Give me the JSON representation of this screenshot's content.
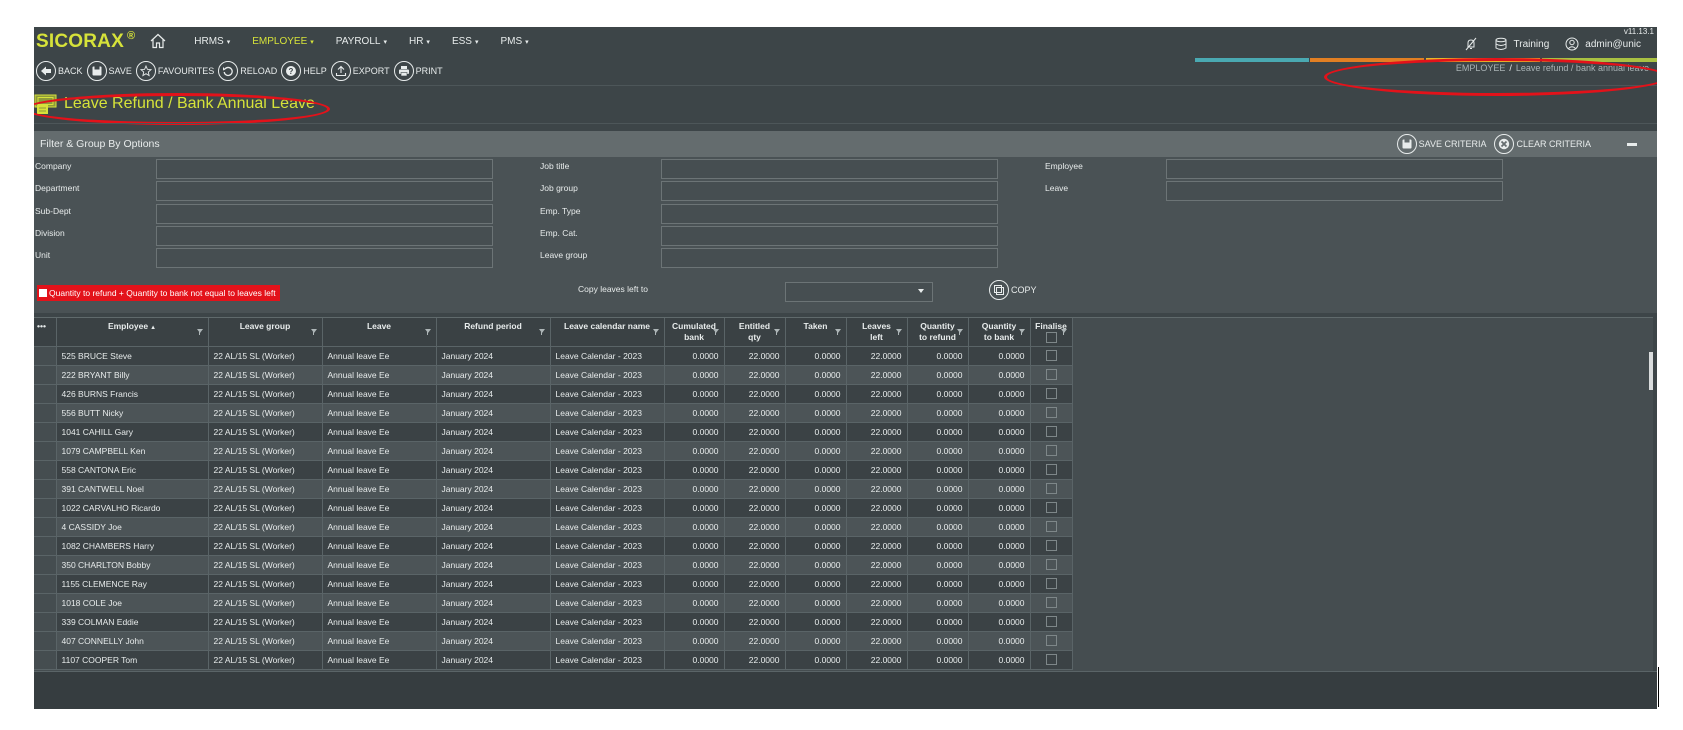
{
  "app": {
    "logo": "SICORAX",
    "logo_mark": "®",
    "version": "v11.13.1",
    "nav": [
      {
        "label": "HRMS",
        "active": false
      },
      {
        "label": "EMPLOYEE",
        "active": true
      },
      {
        "label": "PAYROLL",
        "active": false
      },
      {
        "label": "HR",
        "active": false
      },
      {
        "label": "ESS",
        "active": false
      },
      {
        "label": "PMS",
        "active": false
      }
    ],
    "environment": "Training",
    "user": "admin@unic",
    "colors": {
      "accent": "#d6e23a",
      "background": "#3d4548",
      "warning": "#e3121a",
      "ribbon": [
        "#4aa9b2",
        "#e27f23",
        "#e6b72a",
        "#a9c142"
      ]
    }
  },
  "toolbar": {
    "back": "BACK",
    "save": "SAVE",
    "favourites": "FAVOURITES",
    "reload": "RELOAD",
    "help": "HELP",
    "export": "EXPORT",
    "print": "PRINT"
  },
  "breadcrumb": {
    "section": "EMPLOYEE",
    "separator": "/",
    "page": "Leave refund / bank annual leave"
  },
  "page": {
    "title": "Leave Refund / Bank Annual Leave"
  },
  "filter": {
    "title": "Filter & Group By Options",
    "save_criteria": "SAVE CRITERIA",
    "clear_criteria": "CLEAR CRITERIA",
    "col1": [
      {
        "label": "Company",
        "value": ""
      },
      {
        "label": "Department",
        "value": ""
      },
      {
        "label": "Sub-Dept",
        "value": ""
      },
      {
        "label": "Division",
        "value": ""
      },
      {
        "label": "Unit",
        "value": ""
      }
    ],
    "col2": [
      {
        "label": "Job title",
        "value": ""
      },
      {
        "label": "Job group",
        "value": ""
      },
      {
        "label": "Emp. Type",
        "value": ""
      },
      {
        "label": "Emp. Cat.",
        "value": ""
      },
      {
        "label": "Leave group",
        "value": ""
      }
    ],
    "col3": [
      {
        "label": "Employee",
        "value": ""
      },
      {
        "label": "Leave",
        "value": ""
      }
    ],
    "warning_checkbox": "Quantity to refund + Quantity to bank not equal to leaves left",
    "copy_label": "Copy leaves left to",
    "copy_select_value": "",
    "copy_button": "COPY"
  },
  "grid": {
    "columns": [
      {
        "line1": "Employee",
        "line2": "",
        "sorted": "asc"
      },
      {
        "line1": "Leave group",
        "line2": ""
      },
      {
        "line1": "Leave",
        "line2": ""
      },
      {
        "line1": "Refund period",
        "line2": ""
      },
      {
        "line1": "Leave calendar name",
        "line2": ""
      },
      {
        "line1": "Cumulated",
        "line2": "bank"
      },
      {
        "line1": "Entitled",
        "line2": "qty"
      },
      {
        "line1": "Taken",
        "line2": ""
      },
      {
        "line1": "Leaves",
        "line2": "left"
      },
      {
        "line1": "Quantity",
        "line2": "to refund"
      },
      {
        "line1": "Quantity",
        "line2": "to bank"
      },
      {
        "line1": "Finalise",
        "line2": ""
      }
    ],
    "menu_icon": "•••",
    "rows": [
      {
        "employee": "525 BRUCE Steve",
        "leave_group": "22 AL/15 SL (Worker)",
        "leave": "Annual leave Ee",
        "refund_period": "January 2024",
        "calendar": "Leave Calendar - 2023",
        "cumulated_bank": "0.0000",
        "entitled_qty": "22.0000",
        "taken": "0.0000",
        "leaves_left": "22.0000",
        "qty_refund": "0.0000",
        "qty_bank": "0.0000",
        "finalise": false
      },
      {
        "employee": "222 BRYANT Billy",
        "leave_group": "22 AL/15 SL (Worker)",
        "leave": "Annual leave Ee",
        "refund_period": "January 2024",
        "calendar": "Leave Calendar - 2023",
        "cumulated_bank": "0.0000",
        "entitled_qty": "22.0000",
        "taken": "0.0000",
        "leaves_left": "22.0000",
        "qty_refund": "0.0000",
        "qty_bank": "0.0000",
        "finalise": false
      },
      {
        "employee": "426 BURNS Francis",
        "leave_group": "22 AL/15 SL (Worker)",
        "leave": "Annual leave Ee",
        "refund_period": "January 2024",
        "calendar": "Leave Calendar - 2023",
        "cumulated_bank": "0.0000",
        "entitled_qty": "22.0000",
        "taken": "0.0000",
        "leaves_left": "22.0000",
        "qty_refund": "0.0000",
        "qty_bank": "0.0000",
        "finalise": false
      },
      {
        "employee": "556 BUTT Nicky",
        "leave_group": "22 AL/15 SL (Worker)",
        "leave": "Annual leave Ee",
        "refund_period": "January 2024",
        "calendar": "Leave Calendar - 2023",
        "cumulated_bank": "0.0000",
        "entitled_qty": "22.0000",
        "taken": "0.0000",
        "leaves_left": "22.0000",
        "qty_refund": "0.0000",
        "qty_bank": "0.0000",
        "finalise": false
      },
      {
        "employee": "1041 CAHILL Gary",
        "leave_group": "22 AL/15 SL (Worker)",
        "leave": "Annual leave Ee",
        "refund_period": "January 2024",
        "calendar": "Leave Calendar - 2023",
        "cumulated_bank": "0.0000",
        "entitled_qty": "22.0000",
        "taken": "0.0000",
        "leaves_left": "22.0000",
        "qty_refund": "0.0000",
        "qty_bank": "0.0000",
        "finalise": false
      },
      {
        "employee": "1079 CAMPBELL Ken",
        "leave_group": "22 AL/15 SL (Worker)",
        "leave": "Annual leave Ee",
        "refund_period": "January 2024",
        "calendar": "Leave Calendar - 2023",
        "cumulated_bank": "0.0000",
        "entitled_qty": "22.0000",
        "taken": "0.0000",
        "leaves_left": "22.0000",
        "qty_refund": "0.0000",
        "qty_bank": "0.0000",
        "finalise": false
      },
      {
        "employee": "558 CANTONA Eric",
        "leave_group": "22 AL/15 SL (Worker)",
        "leave": "Annual leave Ee",
        "refund_period": "January 2024",
        "calendar": "Leave Calendar - 2023",
        "cumulated_bank": "0.0000",
        "entitled_qty": "22.0000",
        "taken": "0.0000",
        "leaves_left": "22.0000",
        "qty_refund": "0.0000",
        "qty_bank": "0.0000",
        "finalise": false
      },
      {
        "employee": "391 CANTWELL Noel",
        "leave_group": "22 AL/15 SL (Worker)",
        "leave": "Annual leave Ee",
        "refund_period": "January 2024",
        "calendar": "Leave Calendar - 2023",
        "cumulated_bank": "0.0000",
        "entitled_qty": "22.0000",
        "taken": "0.0000",
        "leaves_left": "22.0000",
        "qty_refund": "0.0000",
        "qty_bank": "0.0000",
        "finalise": false
      },
      {
        "employee": "1022 CARVALHO Ricardo",
        "leave_group": "22 AL/15 SL (Worker)",
        "leave": "Annual leave Ee",
        "refund_period": "January 2024",
        "calendar": "Leave Calendar - 2023",
        "cumulated_bank": "0.0000",
        "entitled_qty": "22.0000",
        "taken": "0.0000",
        "leaves_left": "22.0000",
        "qty_refund": "0.0000",
        "qty_bank": "0.0000",
        "finalise": false
      },
      {
        "employee": "4 CASSIDY Joe",
        "leave_group": "22 AL/15 SL (Worker)",
        "leave": "Annual leave Ee",
        "refund_period": "January 2024",
        "calendar": "Leave Calendar - 2023",
        "cumulated_bank": "0.0000",
        "entitled_qty": "22.0000",
        "taken": "0.0000",
        "leaves_left": "22.0000",
        "qty_refund": "0.0000",
        "qty_bank": "0.0000",
        "finalise": false
      },
      {
        "employee": "1082 CHAMBERS Harry",
        "leave_group": "22 AL/15 SL (Worker)",
        "leave": "Annual leave Ee",
        "refund_period": "January 2024",
        "calendar": "Leave Calendar - 2023",
        "cumulated_bank": "0.0000",
        "entitled_qty": "22.0000",
        "taken": "0.0000",
        "leaves_left": "22.0000",
        "qty_refund": "0.0000",
        "qty_bank": "0.0000",
        "finalise": false
      },
      {
        "employee": "350 CHARLTON Bobby",
        "leave_group": "22 AL/15 SL (Worker)",
        "leave": "Annual leave Ee",
        "refund_period": "January 2024",
        "calendar": "Leave Calendar - 2023",
        "cumulated_bank": "0.0000",
        "entitled_qty": "22.0000",
        "taken": "0.0000",
        "leaves_left": "22.0000",
        "qty_refund": "0.0000",
        "qty_bank": "0.0000",
        "finalise": false
      },
      {
        "employee": "1155 CLEMENCE Ray",
        "leave_group": "22 AL/15 SL (Worker)",
        "leave": "Annual leave Ee",
        "refund_period": "January 2024",
        "calendar": "Leave Calendar - 2023",
        "cumulated_bank": "0.0000",
        "entitled_qty": "22.0000",
        "taken": "0.0000",
        "leaves_left": "22.0000",
        "qty_refund": "0.0000",
        "qty_bank": "0.0000",
        "finalise": false
      },
      {
        "employee": "1018 COLE Joe",
        "leave_group": "22 AL/15 SL (Worker)",
        "leave": "Annual leave Ee",
        "refund_period": "January 2024",
        "calendar": "Leave Calendar - 2023",
        "cumulated_bank": "0.0000",
        "entitled_qty": "22.0000",
        "taken": "0.0000",
        "leaves_left": "22.0000",
        "qty_refund": "0.0000",
        "qty_bank": "0.0000",
        "finalise": false
      },
      {
        "employee": "339 COLMAN Eddie",
        "leave_group": "22 AL/15 SL (Worker)",
        "leave": "Annual leave Ee",
        "refund_period": "January 2024",
        "calendar": "Leave Calendar - 2023",
        "cumulated_bank": "0.0000",
        "entitled_qty": "22.0000",
        "taken": "0.0000",
        "leaves_left": "22.0000",
        "qty_refund": "0.0000",
        "qty_bank": "0.0000",
        "finalise": false
      },
      {
        "employee": "407 CONNELLY John",
        "leave_group": "22 AL/15 SL (Worker)",
        "leave": "Annual leave Ee",
        "refund_period": "January 2024",
        "calendar": "Leave Calendar - 2023",
        "cumulated_bank": "0.0000",
        "entitled_qty": "22.0000",
        "taken": "0.0000",
        "leaves_left": "22.0000",
        "qty_refund": "0.0000",
        "qty_bank": "0.0000",
        "finalise": false
      },
      {
        "employee": "1107 COOPER Tom",
        "leave_group": "22 AL/15 SL (Worker)",
        "leave": "Annual leave Ee",
        "refund_period": "January 2024",
        "calendar": "Leave Calendar - 2023",
        "cumulated_bank": "0.0000",
        "entitled_qty": "22.0000",
        "taken": "0.0000",
        "leaves_left": "22.0000",
        "qty_refund": "0.0000",
        "qty_bank": "0.0000",
        "finalise": false
      }
    ]
  }
}
